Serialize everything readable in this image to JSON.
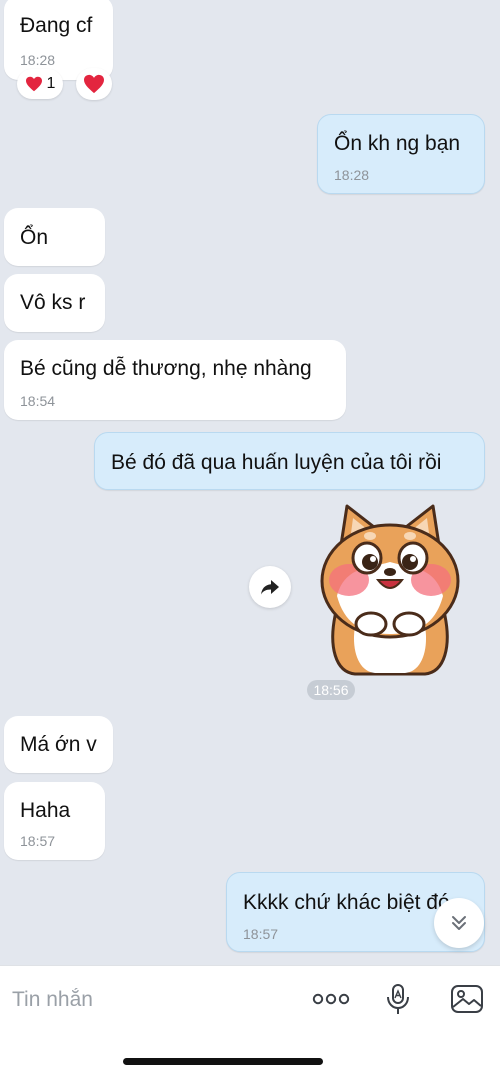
{
  "composer": {
    "placeholder": "Tin nhắn"
  },
  "icons": {
    "more": "more-dots-icon",
    "voice": "microphone-icon",
    "image": "image-icon",
    "share": "share-forward-icon",
    "scroll": "double-chevron-down-icon",
    "reaction": "heart-icon"
  },
  "colors": {
    "background": "#e3e7ee",
    "incoming_bubble": "#ffffff",
    "outgoing_bubble": "#d7ecfb",
    "heart": "#e3253f"
  },
  "messages": [
    {
      "side": "in",
      "text": "Đang cf",
      "time": "18:28",
      "reaction_count": "1"
    },
    {
      "side": "out",
      "text": "Ổn kh ng bạn",
      "time": "18:28"
    },
    {
      "side": "in",
      "text": "Ổn"
    },
    {
      "side": "in",
      "text": "Vô ks r"
    },
    {
      "side": "in",
      "text": "Bé cũng dễ thương, nhẹ nhàng",
      "time": "18:54"
    },
    {
      "side": "out",
      "text": "Bé đó đã qua huấn luyện của tôi rồi"
    },
    {
      "side": "out",
      "type": "sticker",
      "description": "shiba-dog-sticker",
      "time": "18:56"
    },
    {
      "side": "in",
      "text": "Má ớn v"
    },
    {
      "side": "in",
      "text": "Haha",
      "time": "18:57"
    },
    {
      "side": "out",
      "text": "Kkkk chứ khác biệt đó",
      "time": "18:57"
    }
  ]
}
